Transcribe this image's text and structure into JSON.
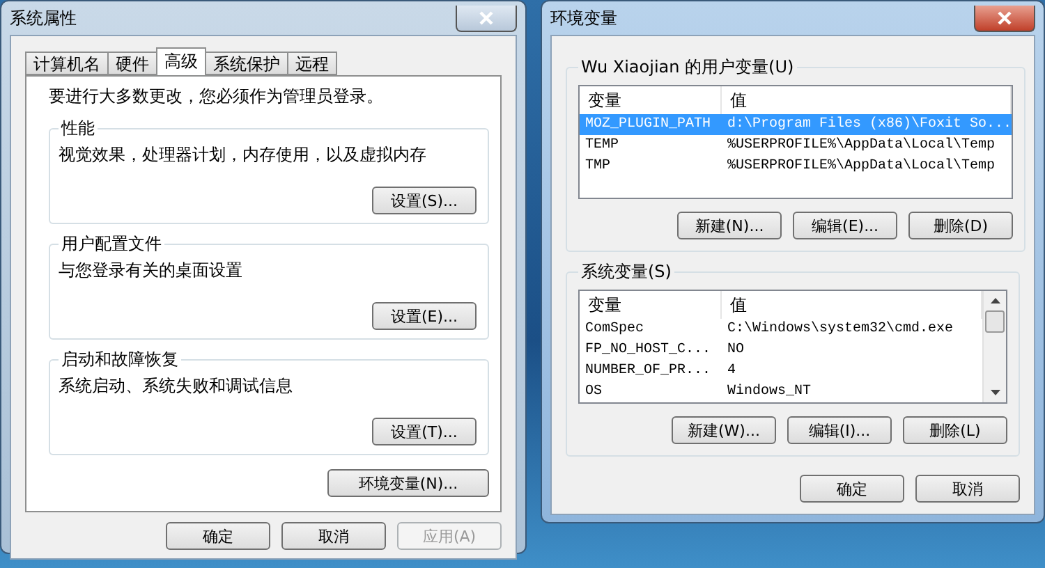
{
  "left_window": {
    "title": "系统属性",
    "active": false,
    "tabs": [
      {
        "label": "计算机名",
        "selected": false
      },
      {
        "label": "硬件",
        "selected": false
      },
      {
        "label": "高级",
        "selected": true
      },
      {
        "label": "系统保护",
        "selected": false
      },
      {
        "label": "远程",
        "selected": false
      }
    ],
    "note": "要进行大多数更改，您必须作为管理员登录。",
    "groups": [
      {
        "title": "性能",
        "description": "视觉效果，处理器计划，内存使用，以及虚拟内存",
        "button": "设置(S)..."
      },
      {
        "title": "用户配置文件",
        "description": "与您登录有关的桌面设置",
        "button": "设置(E)..."
      },
      {
        "title": "启动和故障恢复",
        "description": "系统启动、系统失败和调试信息",
        "button": "设置(T)..."
      }
    ],
    "env_button": "环境变量(N)...",
    "footer_buttons": [
      {
        "label": "确定",
        "disabled": false
      },
      {
        "label": "取消",
        "disabled": false
      },
      {
        "label": "应用(A)",
        "disabled": true
      }
    ]
  },
  "right_window": {
    "title": "环境变量",
    "active": true,
    "lists": [
      {
        "title": "Wu Xiaojian 的用户变量(U)",
        "columns": [
          "变量",
          "值"
        ],
        "scrollbar": false,
        "rows": [
          {
            "name": "MOZ_PLUGIN_PATH",
            "value": "d:\\Program Files (x86)\\Foxit So...",
            "selected": true
          },
          {
            "name": "TEMP",
            "value": "%USERPROFILE%\\AppData\\Local\\Temp",
            "selected": false
          },
          {
            "name": "TMP",
            "value": "%USERPROFILE%\\AppData\\Local\\Temp",
            "selected": false
          }
        ],
        "buttons": [
          "新建(N)...",
          "编辑(E)...",
          "删除(D)"
        ]
      },
      {
        "title": "系统变量(S)",
        "columns": [
          "变量",
          "值"
        ],
        "scrollbar": true,
        "rows": [
          {
            "name": "ComSpec",
            "value": "C:\\Windows\\system32\\cmd.exe",
            "selected": false
          },
          {
            "name": "FP_NO_HOST_C...",
            "value": "NO",
            "selected": false
          },
          {
            "name": "NUMBER_OF_PR...",
            "value": "4",
            "selected": false
          },
          {
            "name": "OS",
            "value": "Windows_NT",
            "selected": false
          }
        ],
        "buttons": [
          "新建(W)...",
          "编辑(I)...",
          "删除(L)"
        ]
      }
    ],
    "footer_buttons": [
      {
        "label": "确定",
        "disabled": false
      },
      {
        "label": "取消",
        "disabled": false
      }
    ]
  }
}
